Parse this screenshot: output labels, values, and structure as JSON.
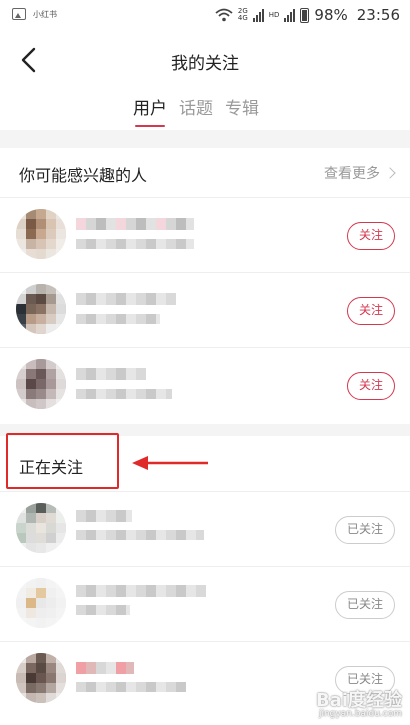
{
  "status_bar": {
    "app_label": "小红书",
    "network_top": "2G",
    "network_bottom": "4G",
    "hd_label": "HD",
    "battery": "98%",
    "time": "23:56"
  },
  "header": {
    "title": "我的关注",
    "tabs": [
      {
        "label": "用户",
        "active": true
      },
      {
        "label": "话题",
        "active": false
      },
      {
        "label": "专辑",
        "active": false
      }
    ]
  },
  "suggested": {
    "title": "你可能感兴趣的人",
    "see_more": "查看更多",
    "follow_label": "关注"
  },
  "following": {
    "title": "正在关注",
    "followed_label": "已关注"
  },
  "watermark": {
    "brand": "Bai度经验",
    "site": "jingyan.baidu.com"
  },
  "colors": {
    "accent": "#d4384f",
    "annotation": "#e02a2a"
  }
}
